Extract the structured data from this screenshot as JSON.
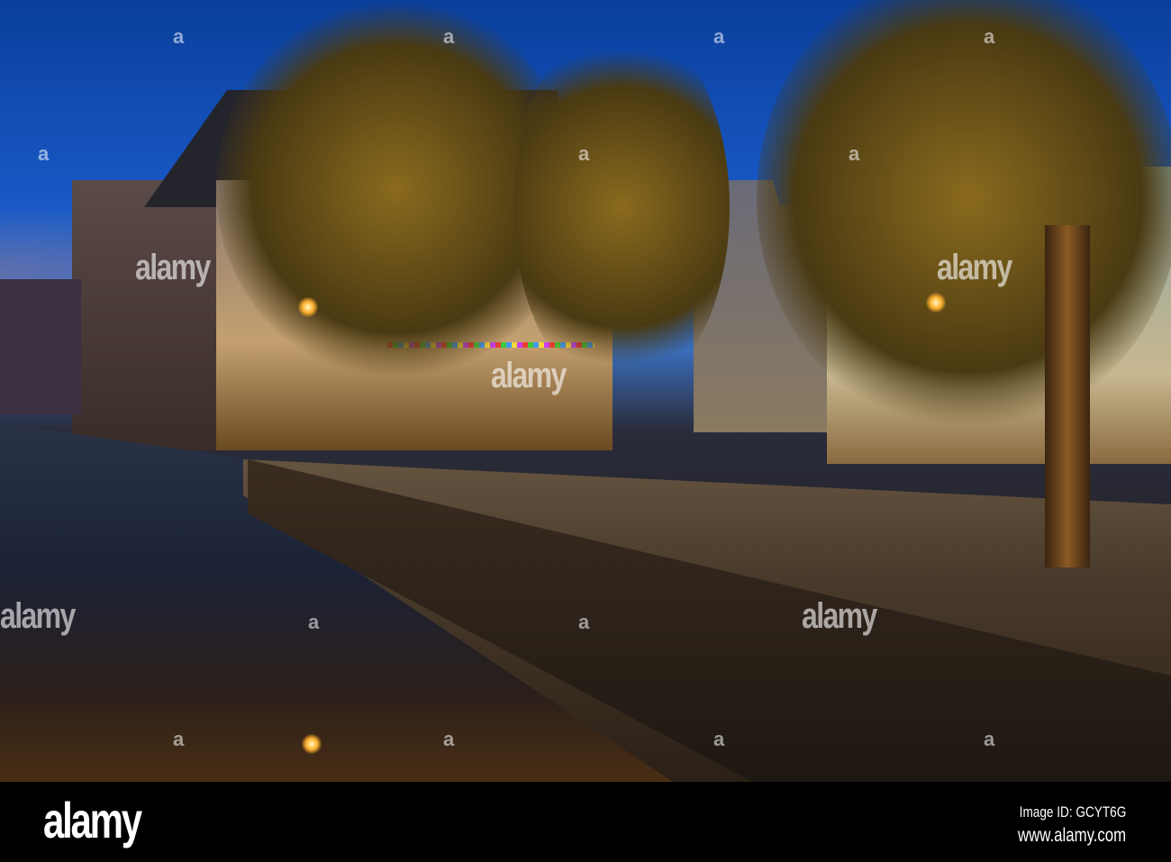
{
  "watermark": {
    "text": "alamy",
    "tile": "a"
  },
  "footer": {
    "logo": "alamy",
    "image_id": "Image ID: GCYT6G",
    "website": "www.alamy.com"
  }
}
